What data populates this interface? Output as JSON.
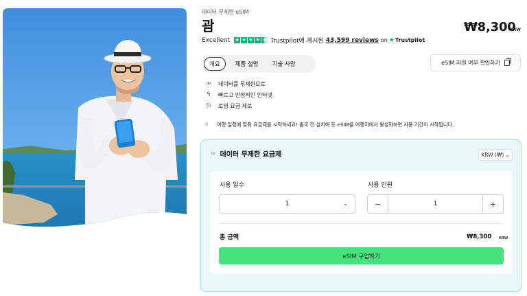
{
  "product": {
    "subtitle": "데이터 무제한 eSIM",
    "title": "괌",
    "price": "₩8,300",
    "price_currency": "KRW"
  },
  "rating": {
    "word": "Excellent",
    "stars": 4.5,
    "prefix": "Trustpilot에 게시된",
    "reviews": "43,599 reviews",
    "on": "on",
    "brand": "Trustpilot",
    "star_color": "#00b67a"
  },
  "tabs": [
    {
      "label": "개요",
      "active": true
    },
    {
      "label": "제품 설명",
      "active": false
    },
    {
      "label": "기술 사양",
      "active": false
    }
  ],
  "compat_button": {
    "label": "eSIM 지원 여부 확인하기",
    "icon": "copy-icon"
  },
  "features": [
    {
      "icon": "infinity-icon",
      "glyph": "∞",
      "label": "데이터를 무제한으로"
    },
    {
      "icon": "bolt-icon",
      "glyph": "ϟ",
      "label": "빠르고 안정적인 인터넷"
    },
    {
      "icon": "no-roaming-icon",
      "glyph": "⍉",
      "label": "로밍 요금 제로"
    }
  ],
  "notice": {
    "icon": "touch-icon",
    "text": "여행 일정에 맞춰 요금제를 시작하세요! 출국 전 설치해 둔 eSIM을 여행지에서 활성화하면 사용 기간이 시작됩니다."
  },
  "plan": {
    "title": "데이터 무제한 요금제",
    "currency_select": "KRW (₩)",
    "days_label": "사용 일수",
    "days_value": "1",
    "people_label": "사용 인원",
    "people_value": "1",
    "minus": "−",
    "plus": "+",
    "total_label": "총 금액",
    "total_value": "₩8,300",
    "total_currency": "KRW",
    "buy_label": "eSIM 구입하기",
    "accent_color": "#47e27e",
    "card_bg": "#eaf7f7"
  }
}
